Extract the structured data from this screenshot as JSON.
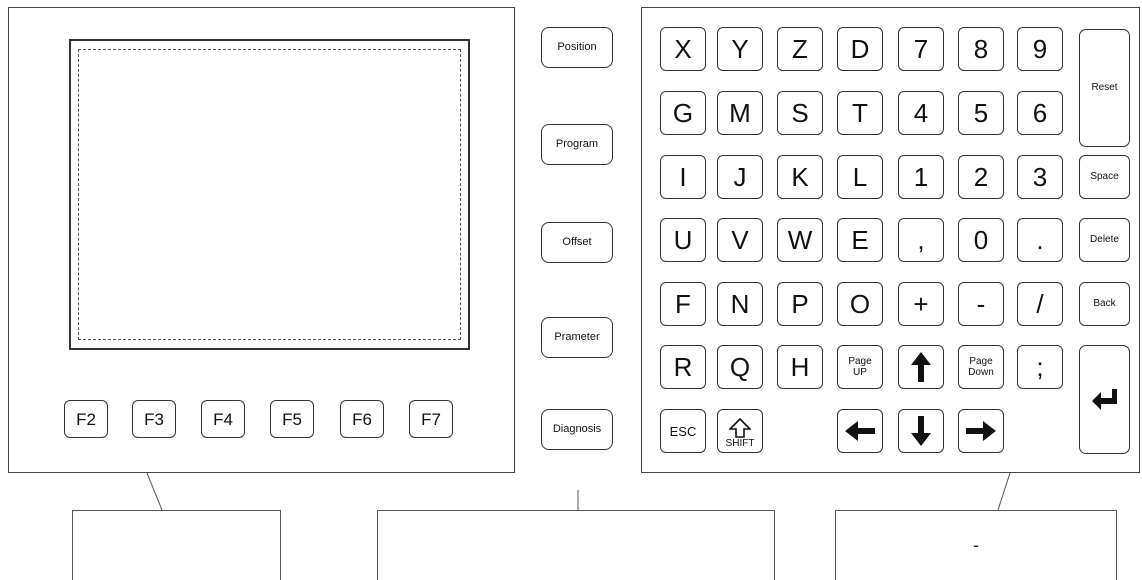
{
  "function_keys": [
    "F2",
    "F3",
    "F4",
    "F5",
    "F6",
    "F7"
  ],
  "mode_keys": [
    "Position",
    "Program",
    "Offset",
    "Prameter",
    "Diagnosis"
  ],
  "keypad": {
    "row1": [
      "X",
      "Y",
      "Z",
      "D",
      "7",
      "8",
      "9"
    ],
    "row2": [
      "G",
      "M",
      "S",
      "T",
      "4",
      "5",
      "6"
    ],
    "row3": [
      "I",
      "J",
      "K",
      "L",
      "1",
      "2",
      "3"
    ],
    "row4": [
      "U",
      "V",
      "W",
      "E",
      ",",
      "0",
      "."
    ],
    "row5": [
      "F",
      "N",
      "P",
      "O",
      "+",
      "-",
      "/"
    ],
    "row6": [
      "R",
      "Q",
      "H"
    ],
    "page_up": {
      "line1": "Page",
      "line2": "UP"
    },
    "page_down": {
      "line1": "Page",
      "line2": "Down"
    },
    "semicolon": ";",
    "esc": "ESC",
    "shift": "SHIFT"
  },
  "side_keys": [
    "Reset",
    "Space",
    "Delete",
    "Back"
  ],
  "labels": {
    "left": "",
    "middle": "",
    "right": "-"
  },
  "icons": [
    "arrow-up-icon",
    "arrow-down-icon",
    "arrow-left-icon",
    "arrow-right-icon",
    "shift-icon",
    "enter-icon"
  ]
}
